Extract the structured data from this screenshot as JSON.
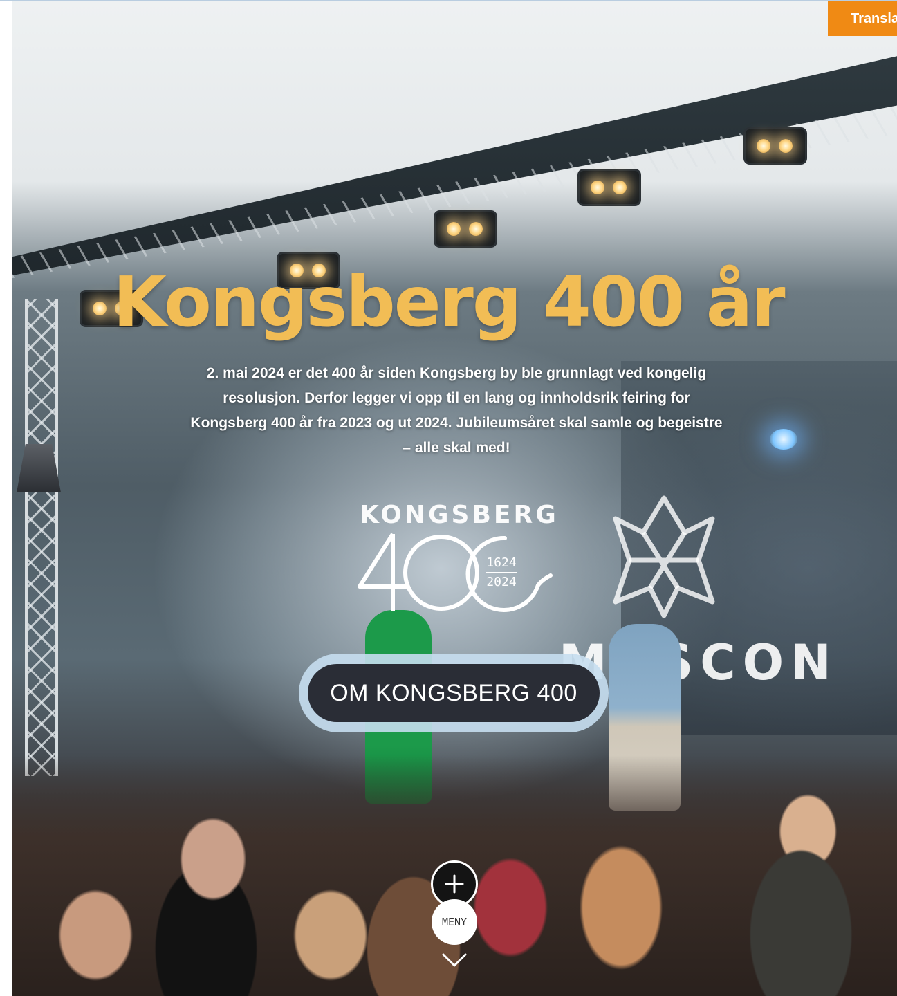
{
  "translate": {
    "label": "Translate"
  },
  "hero": {
    "title": "Kongsberg 400 år",
    "intro": "2. mai 2024 er det 400 år siden Kongsberg by ble grunnlagt ved kongelig resolusjon. Derfor legger vi opp til en lang og innholdsrik feiring for Kongsberg 400 år fra 2023 og ut 2024. Jubileumsåret skal samle og begeistre – alle skal med!",
    "cta_label": "OM KONGSBERG 400"
  },
  "logo": {
    "wordmark": "KONGSBERG",
    "number": "400",
    "year_start": "1624",
    "year_end": "2024"
  },
  "photo": {
    "screen_text": "MASCON"
  },
  "nav": {
    "menu_label": "MENY"
  },
  "colors": {
    "title": "#f2bd55",
    "cta_background": "#2a2d36",
    "cta_ring": "#c6def0",
    "translate_tab": "#f08a14"
  },
  "icons": {
    "menu_toggle": "plus-icon",
    "scroll": "chevron-down-icon"
  }
}
